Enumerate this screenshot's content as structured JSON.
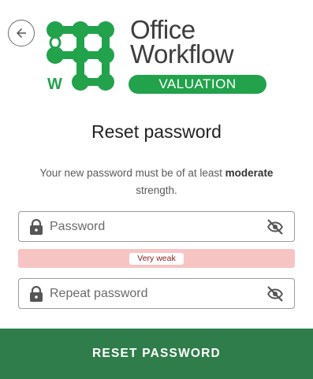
{
  "brand": {
    "name": "Office\nWorkflow",
    "badge": "VALUATION",
    "logo_letters": "OW",
    "color": "#22a24b"
  },
  "page": {
    "title": "Reset password",
    "subtitle_pre": "Your new password must be of at least ",
    "subtitle_strong": "moderate",
    "subtitle_post": " strength."
  },
  "form": {
    "password_placeholder": "Password",
    "repeat_placeholder": "Repeat password",
    "strength_label": "Very weak",
    "strength_color": "#f7c4c4",
    "submit_label": "RESET PASSWORD",
    "submit_color": "#2f7d4a"
  },
  "icons": {
    "back": "arrow-left-icon",
    "lock": "lock-icon",
    "visibility": "eye-off-icon"
  }
}
